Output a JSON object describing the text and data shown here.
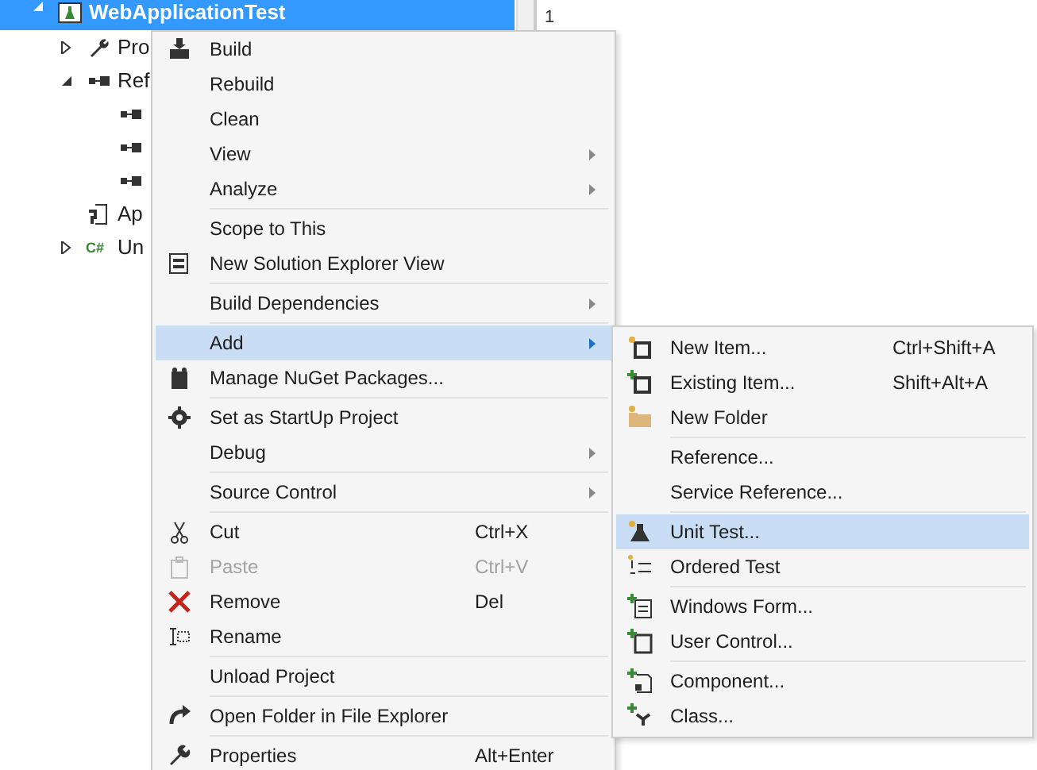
{
  "tree": {
    "items": [
      {
        "label": "WebApplicationTest",
        "selected": true,
        "expanded": true,
        "children": [
          {
            "label": "Pro",
            "expanded": false
          },
          {
            "label": "Ref",
            "expanded": true,
            "children": [
              {
                "kind": "reference"
              },
              {
                "kind": "reference"
              },
              {
                "kind": "reference"
              }
            ]
          },
          {
            "label": "Ap"
          },
          {
            "label": "Un",
            "expanded": false,
            "icon_text": "C#"
          }
        ]
      }
    ]
  },
  "side_panel": {
    "label": "1"
  },
  "context_menu": {
    "items": [
      {
        "kind": "item",
        "label": "Build",
        "submenu": false
      },
      {
        "kind": "item",
        "label": "Rebuild",
        "submenu": false
      },
      {
        "kind": "item",
        "label": "Clean",
        "submenu": false
      },
      {
        "kind": "item",
        "label": "View",
        "submenu": true
      },
      {
        "kind": "item",
        "label": "Analyze",
        "submenu": true
      },
      {
        "kind": "separator"
      },
      {
        "kind": "item",
        "label": "Scope to This",
        "submenu": false
      },
      {
        "kind": "item",
        "label": "New Solution Explorer View",
        "submenu": false
      },
      {
        "kind": "separator"
      },
      {
        "kind": "item",
        "label": "Build Dependencies",
        "submenu": true
      },
      {
        "kind": "separator"
      },
      {
        "kind": "item",
        "label": "Add",
        "submenu": true,
        "selected": true
      },
      {
        "kind": "item",
        "label": "Manage NuGet Packages...",
        "submenu": false
      },
      {
        "kind": "separator"
      },
      {
        "kind": "item",
        "label": "Set as StartUp Project",
        "submenu": false
      },
      {
        "kind": "item",
        "label": "Debug",
        "submenu": true
      },
      {
        "kind": "separator"
      },
      {
        "kind": "item",
        "label": "Source Control",
        "submenu": true
      },
      {
        "kind": "separator"
      },
      {
        "kind": "item",
        "label": "Cut",
        "shortcut": "Ctrl+X",
        "submenu": false
      },
      {
        "kind": "item",
        "label": "Paste",
        "shortcut": "Ctrl+V",
        "submenu": false,
        "disabled": true
      },
      {
        "kind": "item",
        "label": "Remove",
        "shortcut": "Del",
        "submenu": false
      },
      {
        "kind": "item",
        "label": "Rename",
        "submenu": false
      },
      {
        "kind": "separator"
      },
      {
        "kind": "item",
        "label": "Unload Project",
        "submenu": false
      },
      {
        "kind": "separator"
      },
      {
        "kind": "item",
        "label": "Open Folder in File Explorer",
        "submenu": false
      },
      {
        "kind": "separator"
      },
      {
        "kind": "item",
        "label": "Properties",
        "shortcut": "Alt+Enter",
        "submenu": false
      }
    ]
  },
  "add_submenu": {
    "items": [
      {
        "kind": "item",
        "label": "New Item...",
        "shortcut": "Ctrl+Shift+A"
      },
      {
        "kind": "item",
        "label": "Existing Item...",
        "shortcut": "Shift+Alt+A"
      },
      {
        "kind": "item",
        "label": "New Folder"
      },
      {
        "kind": "separator"
      },
      {
        "kind": "item",
        "label": "Reference..."
      },
      {
        "kind": "item",
        "label": "Service Reference..."
      },
      {
        "kind": "separator"
      },
      {
        "kind": "item",
        "label": "Unit Test...",
        "selected": true
      },
      {
        "kind": "item",
        "label": "Ordered Test"
      },
      {
        "kind": "separator"
      },
      {
        "kind": "item",
        "label": "Windows Form..."
      },
      {
        "kind": "item",
        "label": "User Control..."
      },
      {
        "kind": "separator"
      },
      {
        "kind": "item",
        "label": "Component..."
      },
      {
        "kind": "item",
        "label": "Class..."
      }
    ]
  }
}
